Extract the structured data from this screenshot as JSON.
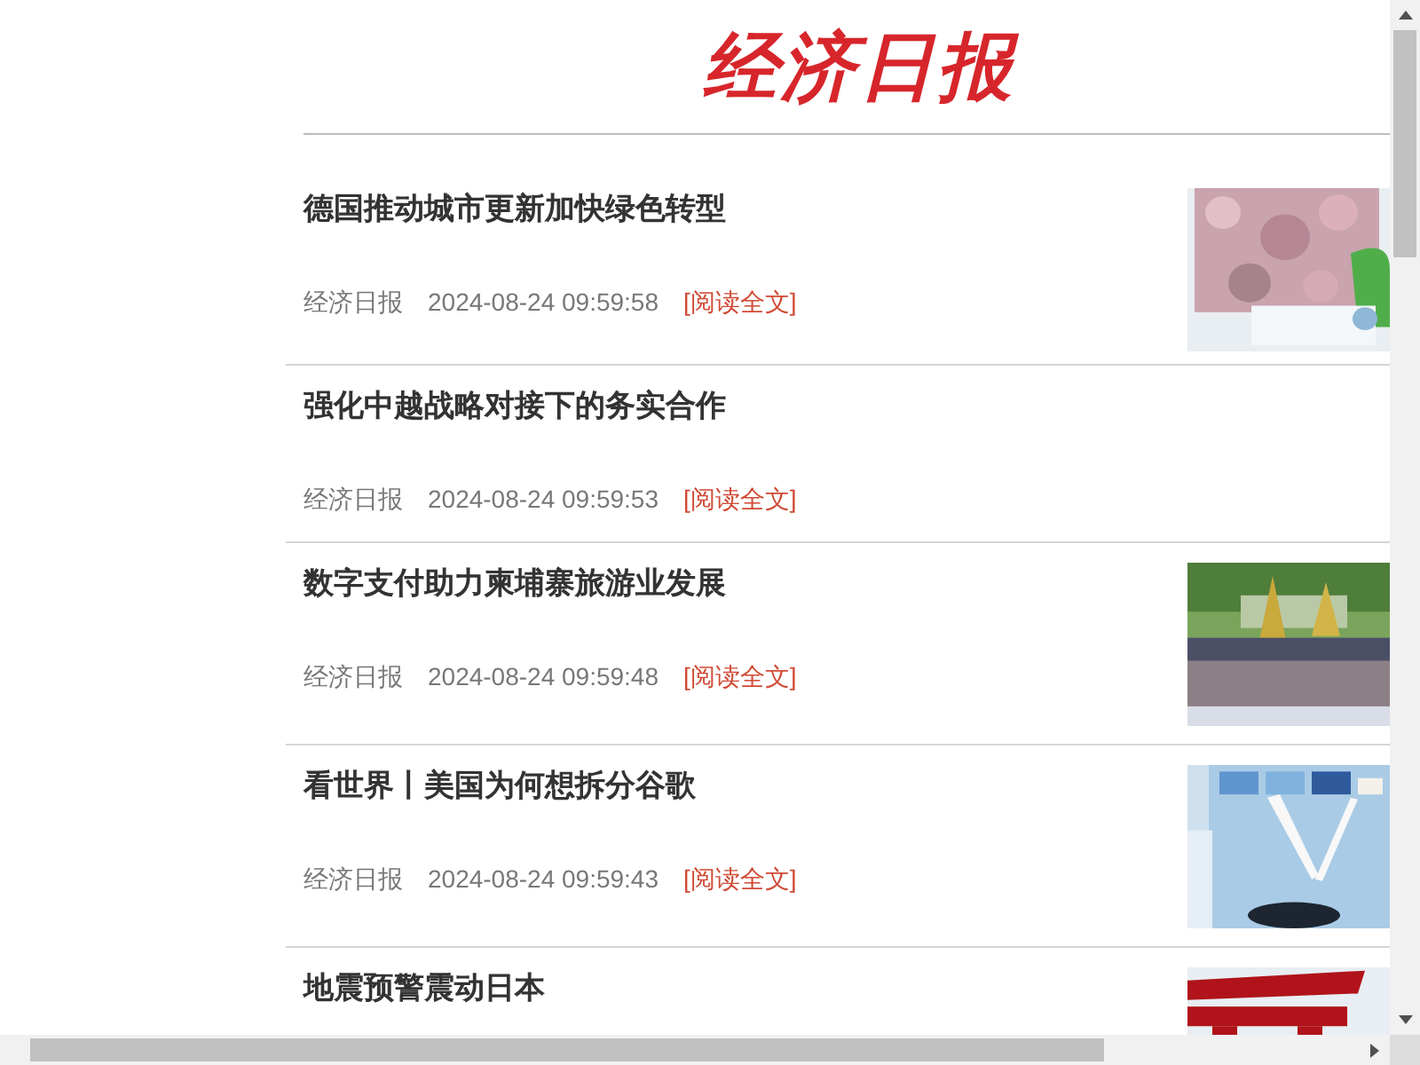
{
  "logo": "经济日报",
  "articles": [
    {
      "title": "德国推动城市更新加快绿色转型",
      "source": "经济日报",
      "time": "2024-08-24 09:59:58",
      "link": "[阅读全文]"
    },
    {
      "title": "强化中越战略对接下的务实合作",
      "source": "经济日报",
      "time": "2024-08-24 09:59:53",
      "link": "[阅读全文]"
    },
    {
      "title": "数字支付助力柬埔寨旅游业发展",
      "source": "经济日报",
      "time": "2024-08-24 09:59:48",
      "link": "[阅读全文]"
    },
    {
      "title": "看世界丨美国为何想拆分谷歌",
      "source": "经济日报",
      "time": "2024-08-24 09:59:43",
      "link": "[阅读全文]"
    },
    {
      "title": "地震预警震动日本"
    }
  ]
}
